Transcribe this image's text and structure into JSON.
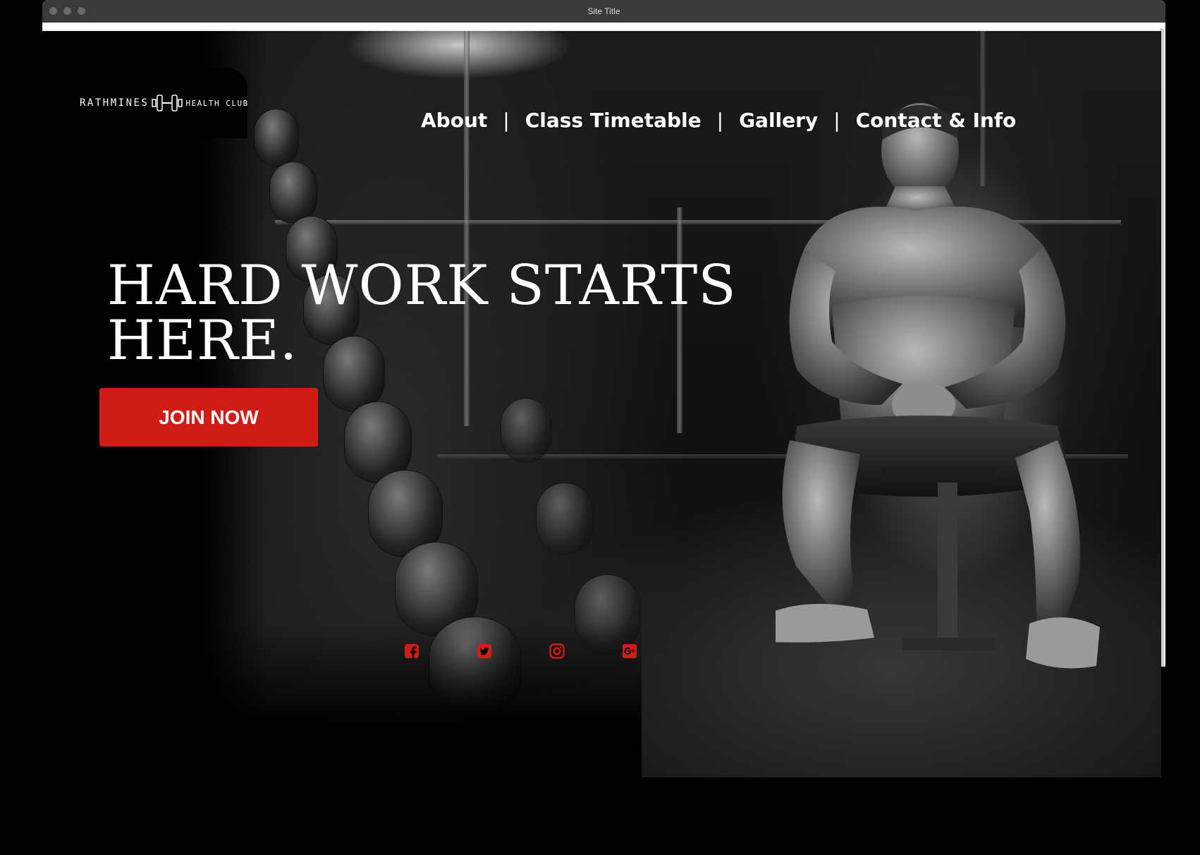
{
  "window": {
    "title": "Site Title"
  },
  "brand": {
    "name_left": "RATHMINES",
    "name_right": "HEALTH CLUB"
  },
  "nav": {
    "items": [
      "About",
      "Class Timetable",
      "Gallery",
      "Contact & Info"
    ],
    "separator": "|"
  },
  "hero": {
    "headline_line1": "HARD WORK STARTS",
    "headline_line2": "HERE.",
    "cta_label": "JOIN NOW"
  },
  "social": {
    "icons": [
      "facebook-icon",
      "twitter-icon",
      "instagram-icon",
      "google-plus-icon"
    ]
  },
  "colors": {
    "accent": "#cf1c17",
    "background": "#000000",
    "text": "#ffffff",
    "titlebar": "#3a3a3a"
  }
}
